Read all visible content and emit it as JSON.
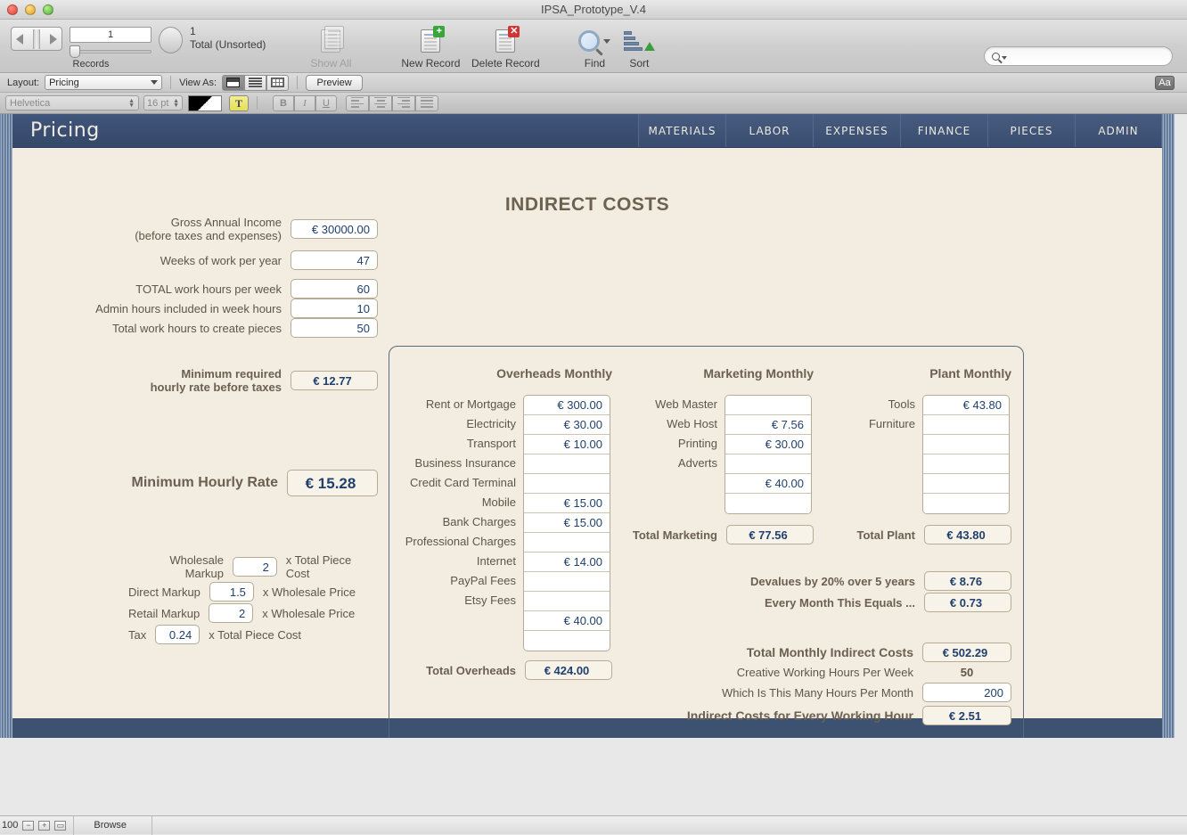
{
  "window": {
    "title": "IPSA_Prototype_V.4"
  },
  "toolbar": {
    "record_number": "1",
    "total_count": "1",
    "total_label": "Total (Unsorted)",
    "records_label": "Records",
    "buttons": [
      {
        "label": "Show All",
        "icon": "stack-document-icon",
        "disabled": true
      },
      {
        "label": "New Record",
        "icon": "document-plus-icon",
        "disabled": false
      },
      {
        "label": "Delete Record",
        "icon": "document-delete-icon",
        "disabled": false
      },
      {
        "label": "Find",
        "icon": "magnifier-icon",
        "disabled": false
      },
      {
        "label": "Sort",
        "icon": "sort-ascending-icon",
        "disabled": false
      }
    ],
    "search_placeholder": ""
  },
  "layoutbar": {
    "layout_label": "Layout:",
    "layout_value": "Pricing",
    "view_as_label": "View As:",
    "preview_label": "Preview",
    "text_format_label": "Aa"
  },
  "formatbar": {
    "font": "Helvetica",
    "size": "16 pt",
    "bold": "B",
    "italic": "I",
    "underline": "U",
    "text_button": "T"
  },
  "nav": {
    "title": "Pricing",
    "tabs": [
      "MATERIALS",
      "LABOR",
      "EXPENSES",
      "FINANCE",
      "PIECES",
      "ADMIN"
    ]
  },
  "page": {
    "heading": "INDIRECT COSTS"
  },
  "income": [
    {
      "label_line1": "Gross Annual Income",
      "label_line2": "(before taxes and expenses)",
      "value": "€ 30000.00"
    },
    {
      "label_line1": "Weeks of work per year",
      "label_line2": "",
      "value": "47"
    },
    {
      "label_line1": "TOTAL work hours per week",
      "label_line2": "",
      "value": "60"
    },
    {
      "label_line1": "Admin hours included in week hours",
      "label_line2": "",
      "value": "10"
    },
    {
      "label_line1": "Total work hours to create pieces",
      "label_line2": "",
      "value": "50"
    }
  ],
  "min_rate_before_tax": {
    "label_line1": "Minimum required",
    "label_line2": "hourly rate before taxes",
    "value": "€ 12.77"
  },
  "min_hourly_rate": {
    "label": "Minimum Hourly Rate",
    "value": "€ 15.28"
  },
  "markups": [
    {
      "label": "Wholesale Markup",
      "value": "2",
      "suffix": "x Total Piece Cost"
    },
    {
      "label": "Direct Markup",
      "value": "1.5",
      "suffix": "x Wholesale Price"
    },
    {
      "label": "Retail Markup",
      "value": "2",
      "suffix": "x Wholesale Price"
    },
    {
      "label": "Tax",
      "value": "0.24",
      "suffix": "x Total Piece Cost"
    }
  ],
  "overheads": {
    "heading": "Overheads Monthly",
    "labels": [
      "Rent or Mortgage",
      "Electricity",
      "Transport",
      "Business Insurance",
      "Credit Card Terminal",
      "Mobile",
      "Bank Charges",
      "Professional Charges",
      "Internet",
      "PayPal Fees",
      "Etsy Fees",
      "",
      ""
    ],
    "values": [
      "€ 300.00",
      "€ 30.00",
      "€ 10.00",
      "",
      "",
      "€ 15.00",
      "€ 15.00",
      "",
      "€ 14.00",
      "",
      "",
      "€ 40.00",
      ""
    ],
    "total_label": "Total Overheads",
    "total_value": "€ 424.00"
  },
  "marketing": {
    "heading": "Marketing Monthly",
    "labels": [
      "Web Master",
      "Web Host",
      "Printing",
      "Adverts",
      "",
      ""
    ],
    "values": [
      "",
      "€ 7.56",
      "€ 30.00",
      "",
      "€ 40.00",
      ""
    ],
    "total_label": "Total Marketing",
    "total_value": "€ 77.56"
  },
  "plant": {
    "heading": "Plant Monthly",
    "labels": [
      "Tools",
      "Furniture",
      "",
      "",
      "",
      ""
    ],
    "values": [
      "€ 43.80",
      "",
      "",
      "",
      "",
      ""
    ],
    "total_label": "Total Plant",
    "total_value": "€ 43.80"
  },
  "devalue": [
    {
      "label": "Devalues by 20% over 5 years",
      "value": "€ 8.76"
    },
    {
      "label": "Every Month This Equals ...",
      "value": "€ 0.73"
    }
  ],
  "summary": [
    {
      "label": "Total Monthly Indirect Costs",
      "value": "€ 502.29",
      "bold_label": true,
      "boxed": true,
      "bold_value": true
    },
    {
      "label": "Creative Working Hours Per Week",
      "value": "50",
      "bold_label": false,
      "boxed": false,
      "bold_value": true
    },
    {
      "label": "Which Is This Many Hours Per Month",
      "value": "200",
      "bold_label": false,
      "boxed": true,
      "bold_value": false
    },
    {
      "label": "Indirect Costs for Every Working Hour",
      "value": "€ 2.51",
      "bold_label": true,
      "boxed": true,
      "bold_value": true
    }
  ],
  "statusbar": {
    "zoom": "100",
    "mode": "Browse"
  },
  "colors": {
    "nav_blue": "#3d5170",
    "canvas_cream": "#f3ede1",
    "field_value_blue": "#20406e",
    "label_brown": "#5e5546"
  }
}
